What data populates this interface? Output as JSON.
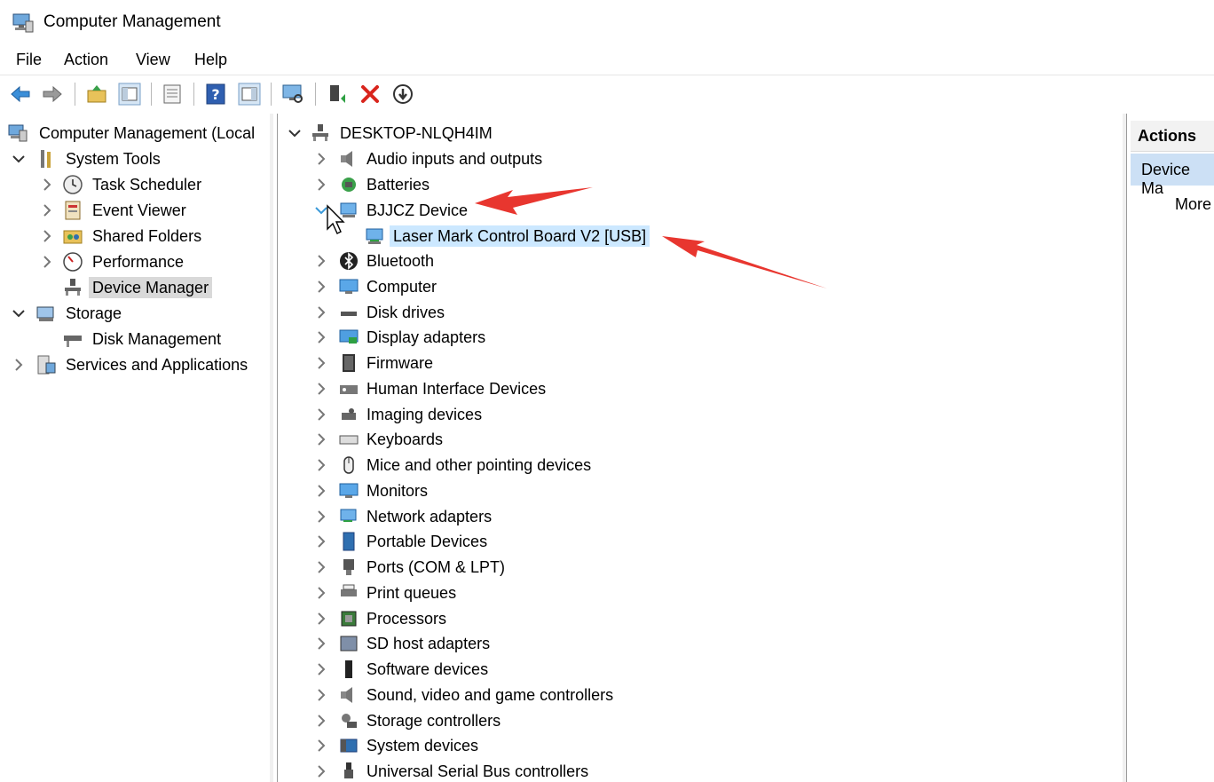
{
  "window": {
    "title": "Computer Management"
  },
  "menu": [
    "File",
    "Action",
    "View",
    "Help"
  ],
  "toolbar": {
    "buttons": [
      "back-icon",
      "forward-icon",
      "up-folder-icon",
      "show-hide-tree-icon",
      "properties-icon",
      "help-icon",
      "show-action-pane-icon",
      "scan-hardware-icon",
      "update-driver-icon",
      "uninstall-icon",
      "disable-device-icon"
    ]
  },
  "tree": {
    "root": "Computer Management (Local",
    "system_tools": "System Tools",
    "task_scheduler": "Task Scheduler",
    "event_viewer": "Event Viewer",
    "shared_folders": "Shared Folders",
    "performance": "Performance",
    "device_manager": "Device Manager",
    "storage": "Storage",
    "disk_management": "Disk Management",
    "services": "Services and Applications"
  },
  "devices": {
    "computer_name": "DESKTOP-NLQH4IM",
    "bjjcz_child": "Laser Mark Control Board V2 [USB]",
    "categories": [
      "Audio inputs and outputs",
      "Batteries",
      "BJJCZ Device",
      "Bluetooth",
      "Computer",
      "Disk drives",
      "Display adapters",
      "Firmware",
      "Human Interface Devices",
      "Imaging devices",
      "Keyboards",
      "Mice and other pointing devices",
      "Monitors",
      "Network adapters",
      "Portable Devices",
      "Ports (COM & LPT)",
      "Print queues",
      "Processors",
      "SD host adapters",
      "Software devices",
      "Sound, video and game controllers",
      "Storage controllers",
      "System devices",
      "Universal Serial Bus controllers"
    ]
  },
  "actions": {
    "title": "Actions",
    "section": "Device Ma",
    "more": "More"
  },
  "colors": {
    "highlight": "#cce8ff",
    "selected": "#d9d9d9",
    "annotation_arrow": "#e8362f"
  }
}
